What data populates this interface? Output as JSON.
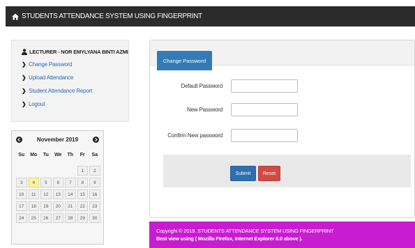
{
  "navbar": {
    "title": "STUDENTS ATTENDANCE SYSTEM USING FINGERPRINT",
    "icon": "home-icon"
  },
  "sidebar": {
    "user_label": "LECTURER - NOR EMYLYANA BINTI AZMI",
    "items": [
      {
        "label": "Change Password"
      },
      {
        "label": "Upload Attendance"
      },
      {
        "label": "Student Attendance Report"
      },
      {
        "label": "Logout"
      }
    ]
  },
  "calendar": {
    "month_label": "November 2019",
    "weekdays": [
      "Su",
      "Mo",
      "Tu",
      "We",
      "Th",
      "Fr",
      "Sa"
    ],
    "days": [
      "",
      "",
      "",
      "",
      "",
      "1",
      "2",
      "3",
      "4",
      "5",
      "6",
      "7",
      "8",
      "9",
      "10",
      "11",
      "12",
      "13",
      "14",
      "15",
      "16",
      "17",
      "18",
      "19",
      "20",
      "21",
      "22",
      "23",
      "24",
      "25",
      "26",
      "27",
      "28",
      "29",
      "30"
    ],
    "today": "4"
  },
  "panel": {
    "tab_label": "Change Password",
    "fields": [
      {
        "label": "Default Password",
        "value": ""
      },
      {
        "label": "New Password",
        "value": ""
      },
      {
        "label": "Confirm New password",
        "value": ""
      }
    ],
    "submit_label": "Submit",
    "reset_label": "Reset"
  },
  "footer": {
    "line1": "Copyright © 2019. STUDENTS ATTENDANCE SYSTEM USING FINGERPRINT",
    "line2": "Best view using ( Mozilla Firefox, Internet Explorer 8.0 above )."
  },
  "colors": {
    "navbar_bg": "#2b2b2b",
    "tab_bg": "#337ab7",
    "submit": "#2d6fb0",
    "reset": "#d24a45",
    "footer_bg": "#c81cd0",
    "today": "#fbf3a9"
  }
}
